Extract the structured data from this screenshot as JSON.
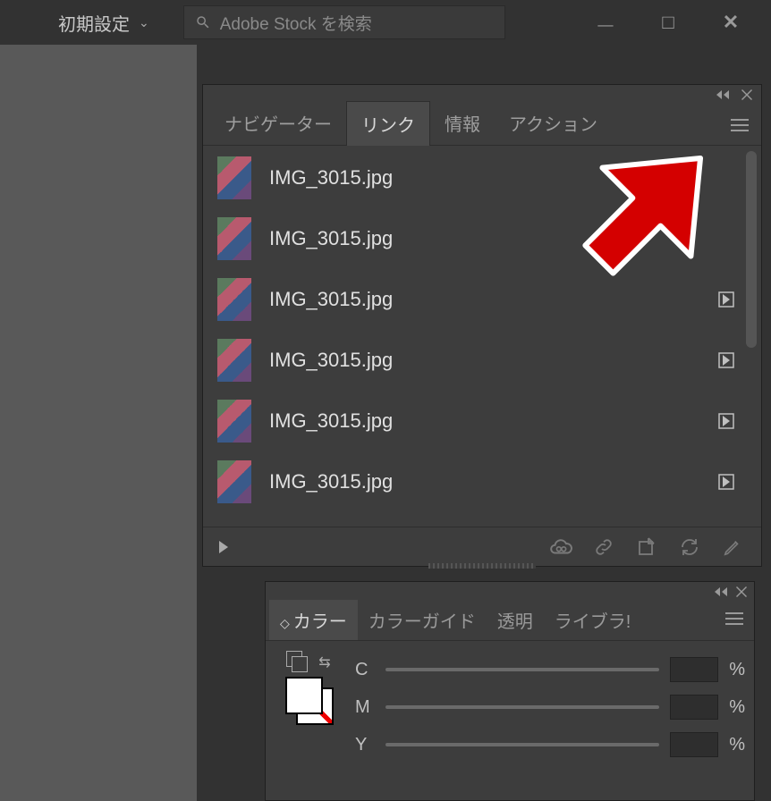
{
  "topbar": {
    "workspace": "初期設定",
    "search_placeholder": "Adobe Stock を検索"
  },
  "links_panel": {
    "tabs": [
      "ナビゲーター",
      "リンク",
      "情報",
      "アクション"
    ],
    "active_tab_index": 1,
    "items": [
      {
        "name": "IMG_3015.jpg",
        "embedded": false
      },
      {
        "name": "IMG_3015.jpg",
        "embedded": false
      },
      {
        "name": "IMG_3015.jpg",
        "embedded": true
      },
      {
        "name": "IMG_3015.jpg",
        "embedded": true
      },
      {
        "name": "IMG_3015.jpg",
        "embedded": true
      },
      {
        "name": "IMG_3015.jpg",
        "embedded": true
      }
    ],
    "footer_icons": [
      "cloud-link-icon",
      "link-icon",
      "place-icon",
      "refresh-icon",
      "edit-icon"
    ]
  },
  "color_panel": {
    "tabs": [
      "カラー",
      "カラーガイド",
      "透明",
      "ライブラ!"
    ],
    "active_tab_index": 0,
    "channels": [
      {
        "label": "C",
        "unit": "%"
      },
      {
        "label": "M",
        "unit": "%"
      },
      {
        "label": "Y",
        "unit": "%"
      }
    ]
  }
}
